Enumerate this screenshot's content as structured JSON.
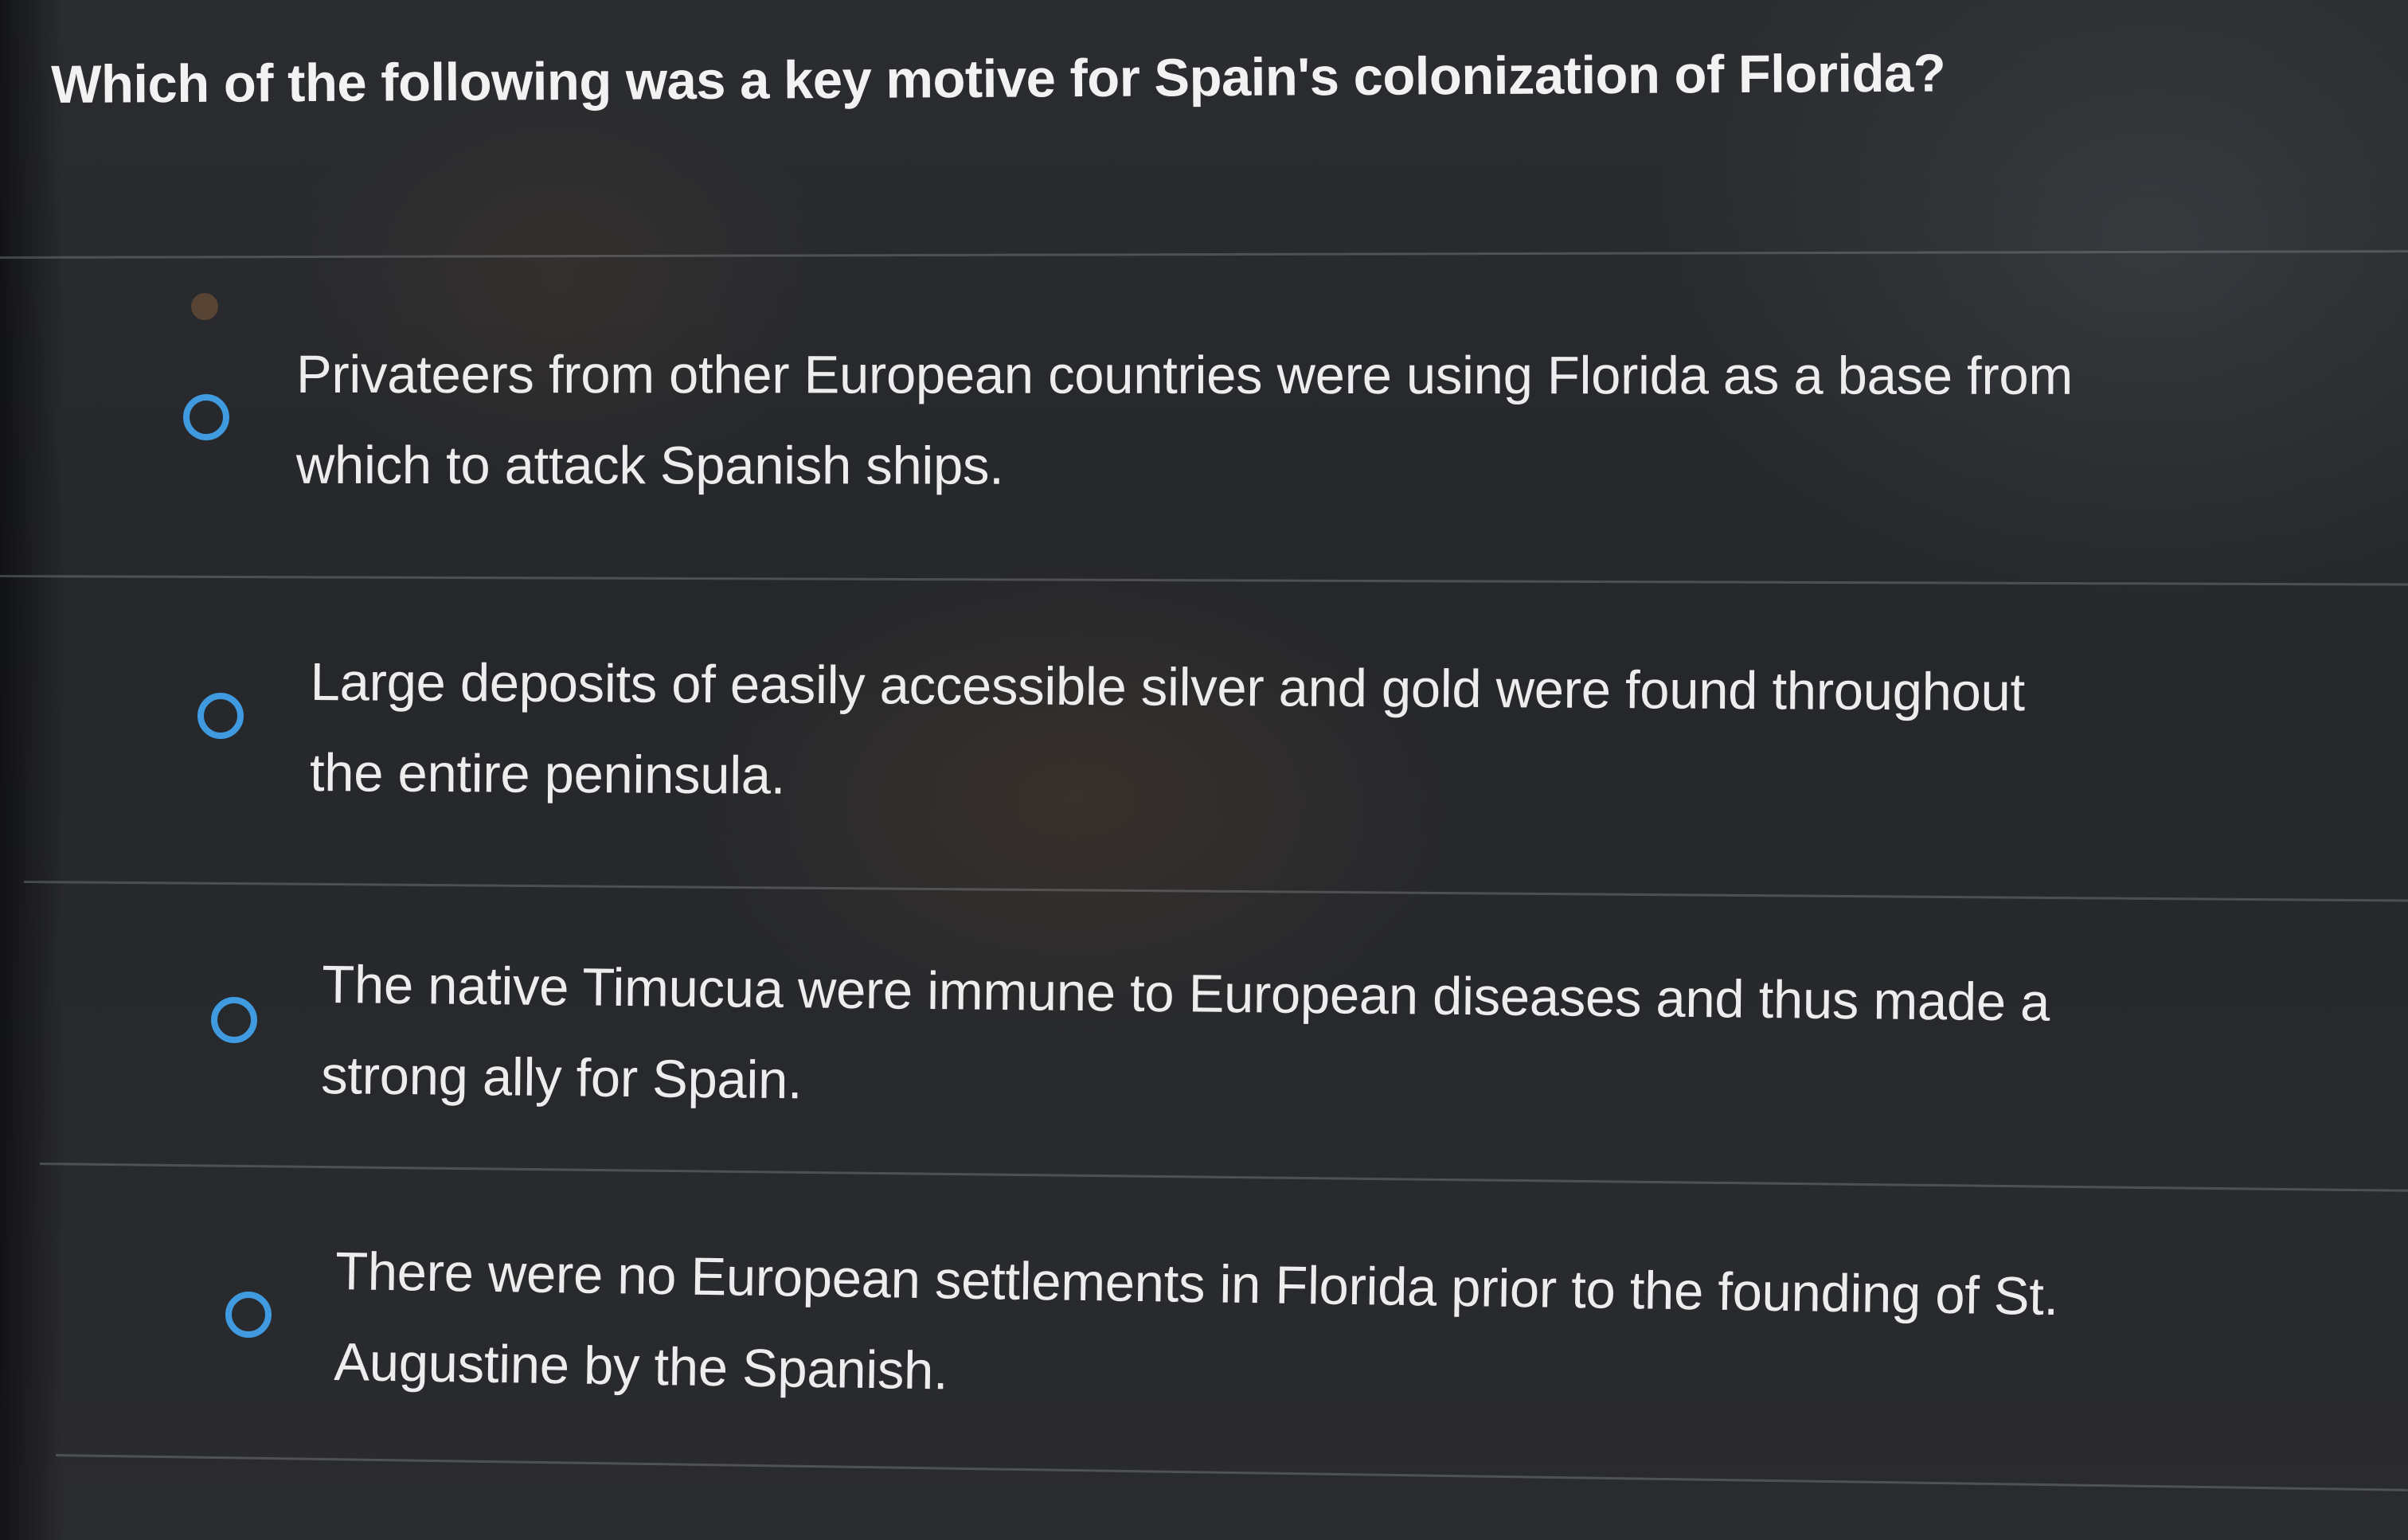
{
  "question": {
    "text": "Which of the following was a key motive for Spain's colonization of Florida?"
  },
  "options": [
    {
      "line1": "Privateers from other European countries were using Florida as a base from",
      "line2": "which to attack Spanish ships.",
      "selected": false
    },
    {
      "line1": "Large deposits of easily accessible silver and gold were found throughout",
      "line2": "the entire peninsula.",
      "selected": false
    },
    {
      "line1": "The native Timucua were immune to European diseases and thus made a",
      "line2": "strong ally for Spain.",
      "selected": false
    },
    {
      "line1": "There were no European settlements in Florida prior to the founding of St.",
      "line2": "Augustine by the Spanish.",
      "selected": false
    }
  ],
  "colors": {
    "radio_border": "#3f9ae0",
    "text": "#ededed",
    "background": "#25272b"
  }
}
